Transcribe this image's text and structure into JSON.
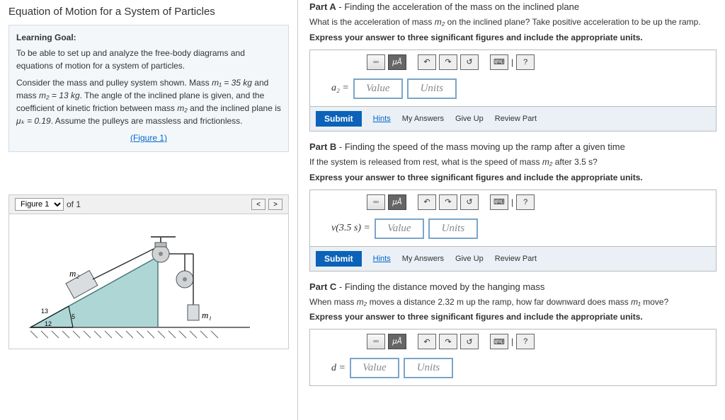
{
  "left": {
    "title": "Equation of Motion for a System of Particles",
    "goal_label": "Learning Goal:",
    "goal_p1": "To be able to set up and analyze the free-body diagrams and equations of motion for a system of particles.",
    "goal_p2_a": "Consider the mass and pulley system shown. Mass ",
    "m1_eq": "m₁ = 35  kg",
    "goal_p2_b": " and mass ",
    "m2_eq": "m₂ = 13  kg",
    "goal_p2_c": ". The angle of the inclined plane is given, and the coefficient of kinetic friction between mass ",
    "m2_sym": "m₂",
    "goal_p2_d": " and the inclined plane is ",
    "mu_eq": "μₖ = 0.19",
    "goal_p2_e": ". Assume the pulleys are massless and frictionless.",
    "figure_link": "(Figure 1)",
    "fig_label": "Figure 1",
    "fig_of": "of 1",
    "nav_prev": "<",
    "nav_next": ">",
    "diagram": {
      "m1": "m₁",
      "m2": "m₂",
      "h": "13",
      "b": "12",
      "hyp": "5"
    }
  },
  "toolbar": {
    "mu": "μÅ",
    "undo": "↶",
    "redo": "↷",
    "reset": "↺",
    "kb": "⌨",
    "sep": "|",
    "help": "?"
  },
  "input": {
    "value_ph": "Value",
    "units_ph": "Units"
  },
  "actions": {
    "submit": "Submit",
    "hints": "Hints",
    "my_answers": "My Answers",
    "give_up": "Give Up",
    "review": "Review Part"
  },
  "partA": {
    "title_b": "Part A",
    "title_r": " - Finding the acceleration of the mass on the inclined plane",
    "q_a": "What is the acceleration of mass ",
    "q_b": " on the inclined plane? Take positive acceleration to be up the ramp.",
    "instr": "Express your answer to three significant figures and include the appropriate units.",
    "label": "a₂ ="
  },
  "partB": {
    "title_b": "Part B",
    "title_r": " - Finding the speed of the mass moving up the ramp after a given time",
    "q_a": "If the system is released from rest, what is the speed of mass ",
    "q_b": " after 3.5  s?",
    "instr": "Express your answer to three significant figures and include the appropriate units.",
    "label": "v(3.5 s) ="
  },
  "partC": {
    "title_b": "Part C",
    "title_r": " - Finding the distance moved by the hanging mass",
    "q_a": "When mass ",
    "q_b": " moves a distance 2.32  m up the ramp, how far downward does mass ",
    "q_c": " move?",
    "instr": "Express your answer to three significant figures and include the appropriate units.",
    "label": "d ="
  },
  "sym": {
    "m1": "m₁",
    "m2": "m₂"
  }
}
